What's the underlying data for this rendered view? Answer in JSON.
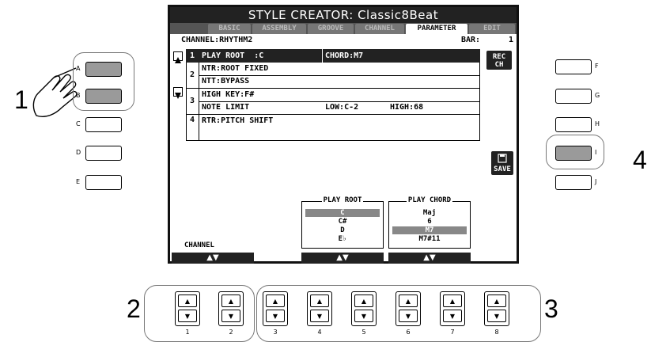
{
  "lcd": {
    "title": "STYLE CREATOR: Classic8Beat",
    "tabs": [
      "BASIC",
      "ASSEMBLY",
      "GROOVE",
      "CHANNEL",
      "PARAMETER",
      "EDIT"
    ],
    "active_tab": "PARAMETER",
    "channel_label": "CHANNEL:RHYTHM2",
    "bar_label": "BAR:",
    "bar_value": "1",
    "rows": [
      {
        "num": "1",
        "lines": [
          "PLAY ROOT  :C",
          "CHORD:M7"
        ]
      },
      {
        "num": "2",
        "lines": [
          "NTR:ROOT FIXED",
          "NTT:BYPASS"
        ]
      },
      {
        "num": "3",
        "lines": [
          "HIGH KEY:F#",
          "NOTE LIMIT",
          "LOW:C-2",
          "HIGH:68"
        ]
      },
      {
        "num": "4",
        "lines": [
          "RTR:PITCH SHIFT"
        ]
      }
    ],
    "rec_ch_label": "REC\nCH",
    "save_label": "SAVE",
    "play_root": {
      "title": "PLAY ROOT",
      "options": [
        "C",
        "C#",
        "D",
        "E♭"
      ],
      "selected": "C"
    },
    "play_chord": {
      "title": "PLAY CHORD",
      "options": [
        "Maj",
        "6",
        "M7",
        "M7#11"
      ],
      "selected": "M7"
    },
    "channel_ctrl_label": "CHANNEL",
    "updown_glyph": "▲▼"
  },
  "left_buttons": [
    "A",
    "B",
    "C",
    "D",
    "E"
  ],
  "right_buttons": [
    "F",
    "G",
    "H",
    "I",
    "J"
  ],
  "bottom_buttons": [
    "1",
    "2",
    "3",
    "4",
    "5",
    "6",
    "7",
    "8"
  ],
  "callouts": {
    "one": "1",
    "two": "2",
    "three": "3",
    "four": "4"
  },
  "arrow_up": "▲",
  "arrow_down": "▼"
}
